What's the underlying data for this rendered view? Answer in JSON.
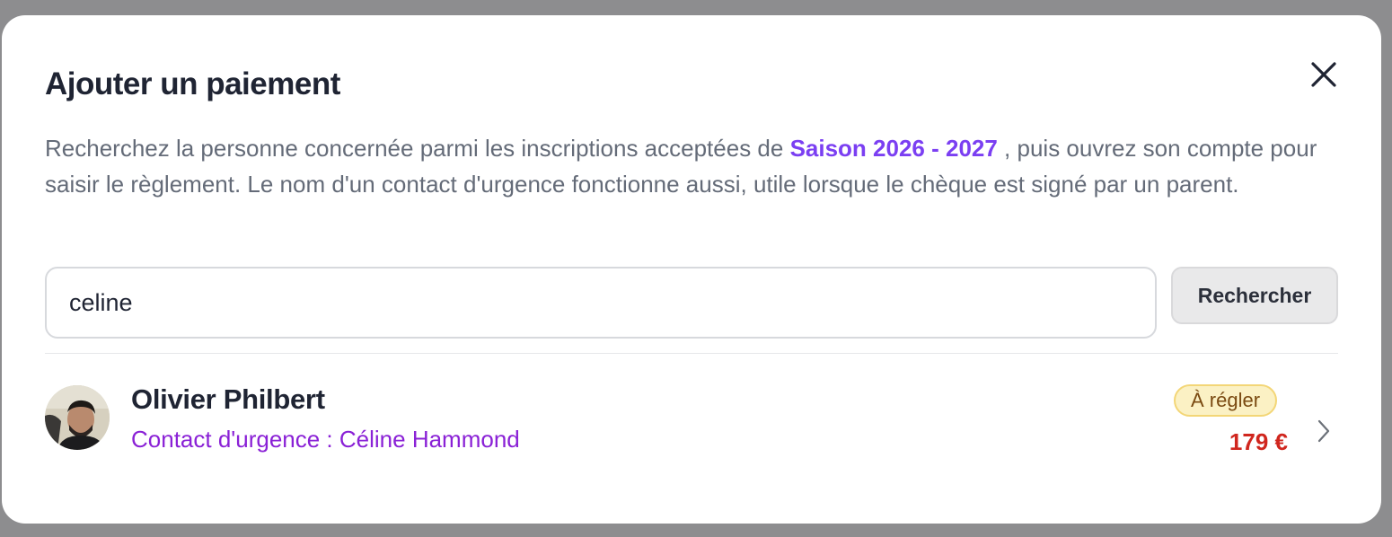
{
  "modal": {
    "title": "Ajouter un paiement",
    "description": {
      "before": "Recherchez la personne concernée parmi les inscriptions acceptées de ",
      "season": "Saison 2026 - 2027",
      "after": " , puis ouvrez son compte pour saisir le règlement. Le nom d'un contact d'urgence fonctionne aussi, utile lorsque le chèque est signé par un parent."
    },
    "close_icon": "close-icon"
  },
  "search": {
    "value": "celine",
    "placeholder": "",
    "button_label": "Rechercher"
  },
  "results": [
    {
      "name": "Olivier Philbert",
      "emergency_contact": "Contact d'urgence : Céline Hammond",
      "status": "À régler",
      "amount": "179 €",
      "chevron_icon": "chevron-right-icon"
    }
  ],
  "colors": {
    "accent": "#7b3ff2",
    "emergency": "#8a21d6",
    "amount_due": "#d0261e",
    "badge_bg": "#fbf1c4",
    "badge_border": "#f3d677",
    "badge_text": "#7a4a11",
    "overlay": "#8d8d8f"
  }
}
